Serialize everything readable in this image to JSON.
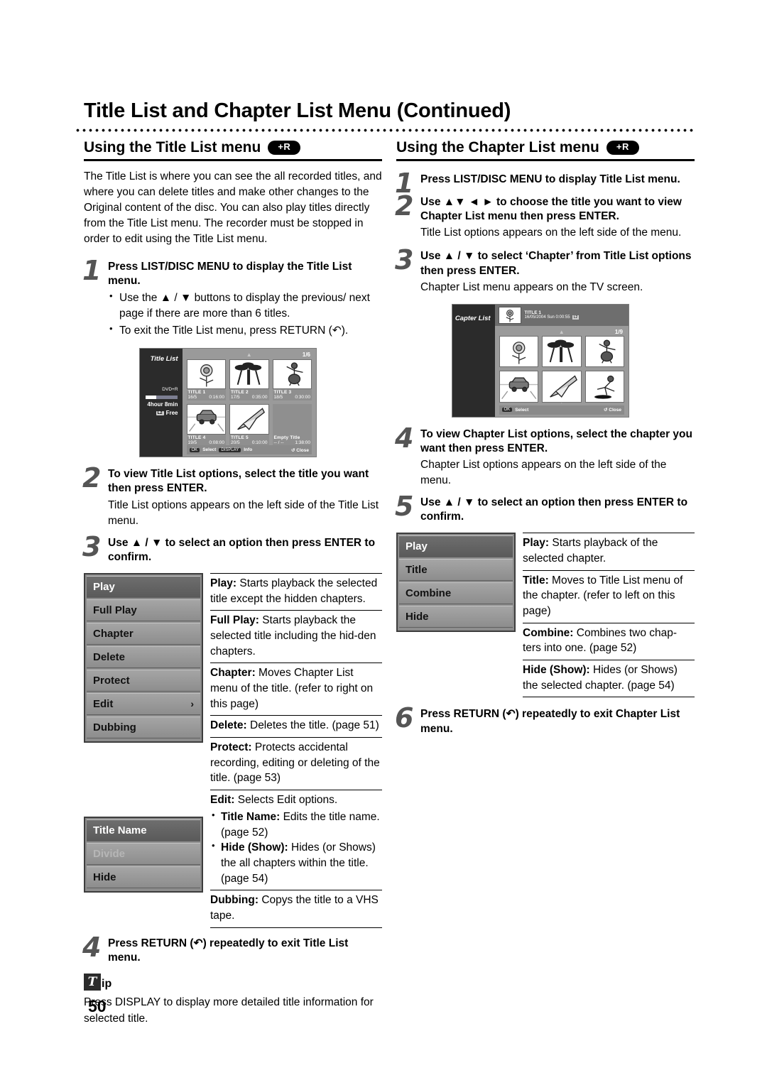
{
  "page": {
    "title": "Title List and Chapter List Menu (Continued)",
    "number": "50"
  },
  "left": {
    "heading": "Using the Title List menu",
    "badge": "+R",
    "intro": "The Title List is where you can see the all recorded titles, and where you can delete titles and make other changes to the Original content of the disc. You can also play titles directly from the Title List menu. The recorder must be stopped in order to edit using the Title List menu.",
    "steps": [
      {
        "num": "1",
        "head": "Press LIST/DISC MENU to display the Title List menu.",
        "bullets": [
          "Use the ▲ / ▼ buttons to display the previous/ next page if there are more than 6 titles.",
          "To exit the Title List menu, press RETURN (↶)."
        ]
      },
      {
        "num": "2",
        "head": "To view Title List options, select the title you want then press ENTER.",
        "sub": "Title List options appears on the left side of the Title List menu."
      },
      {
        "num": "3",
        "head": "Use ▲ / ▼ to select an option then press ENTER to confirm."
      },
      {
        "num": "4",
        "head": "Press RETURN (↶) repeatedly to exit Title List menu."
      }
    ],
    "menu": {
      "items": [
        {
          "label": "Play",
          "state": "selected"
        },
        {
          "label": "Full Play",
          "state": "normal"
        },
        {
          "label": "Chapter",
          "state": "normal"
        },
        {
          "label": "Delete",
          "state": "normal"
        },
        {
          "label": "Protect",
          "state": "normal"
        },
        {
          "label": "Edit",
          "state": "normal",
          "arrow": "›"
        },
        {
          "label": "Dubbing",
          "state": "normal"
        }
      ]
    },
    "submenu": {
      "items": [
        {
          "label": "Title Name",
          "state": "selected"
        },
        {
          "label": "Divide",
          "state": "dim"
        },
        {
          "label": "Hide",
          "state": "normal"
        }
      ]
    },
    "descriptions": [
      {
        "term": "Play:",
        "text": " Starts playback the selected title except the hidden chapters."
      },
      {
        "term": "Full Play:",
        "text": " Starts playback the selected title including the hid-den chapters."
      },
      {
        "term": "Chapter:",
        "text": " Moves Chapter List menu of the title. (refer to right on this page)"
      },
      {
        "term": "Delete:",
        "text": " Deletes the title. (page 51)"
      },
      {
        "term": "Protect:",
        "text": " Protects accidental recording, editing or deleting of the title. (page 53)"
      },
      {
        "term": "Edit:",
        "text": " Selects Edit options.",
        "sub_items": [
          {
            "term": "Title Name:",
            "text": " Edits the title name. (page 52)"
          },
          {
            "term": "Hide (Show):",
            "text": " Hides (or Shows) the all chapters within the title. (page 54)"
          }
        ]
      },
      {
        "term": "Dubbing:",
        "text": " Copys the title to a VHS tape."
      }
    ],
    "tip": {
      "icon_letter": "T",
      "word": "ip",
      "text": "Press DISPLAY to display more detailed title information for selected title."
    },
    "screen": {
      "sidebar_title": "Title List",
      "disc_type": "DVD+R",
      "free_time": "4hour 8min",
      "free_label": "Free",
      "free_chip": "L2",
      "page_indicator": "1/6",
      "cells": [
        {
          "name": "TITLE 1",
          "date": "16/5",
          "time": "0:16:00",
          "art": "rose"
        },
        {
          "name": "TITLE 2",
          "date": "17/5",
          "time": "0:35:00",
          "art": "tree"
        },
        {
          "name": "TITLE 3",
          "date": "18/5",
          "time": "0:30:00",
          "art": "figure"
        },
        {
          "name": "TITLE 4",
          "date": "19/5",
          "time": "0:08:00",
          "art": "car"
        },
        {
          "name": "TITLE 5",
          "date": "20/5",
          "time": "0:10:00",
          "art": "shuttle"
        },
        {
          "name": "Empty Title",
          "date": "-- / --",
          "time": "1:38:00",
          "art": "none"
        }
      ],
      "footer": [
        {
          "key": "OK",
          "label": "Select"
        },
        {
          "key": "DISPLAY",
          "label": "Info"
        }
      ],
      "footer_right": "Close"
    }
  },
  "right": {
    "heading": "Using the Chapter List menu",
    "badge": "+R",
    "steps": [
      {
        "num": "1",
        "head": "Press LIST/DISC MENU to display Title List menu."
      },
      {
        "num": "2",
        "head": "Use ▲▼ ◄ ► to choose the title you want to view Chapter List menu then press ENTER.",
        "sub": "Title List options appears on the left side of the menu."
      },
      {
        "num": "3",
        "head": "Use ▲ / ▼ to select ‘Chapter’ from Title List options then press ENTER.",
        "sub": "Chapter List menu appears on the TV screen."
      },
      {
        "num": "4",
        "head": "To view Chapter List options, select the chapter you want then press ENTER.",
        "sub": "Chapter List options appears on the left side of the menu."
      },
      {
        "num": "5",
        "head": "Use ▲ / ▼ to select an option then press ENTER to confirm."
      },
      {
        "num": "6",
        "head": "Press RETURN (↶) repeatedly to exit Chapter List menu."
      }
    ],
    "menu": {
      "items": [
        {
          "label": "Play",
          "state": "selected"
        },
        {
          "label": "Title",
          "state": "normal"
        },
        {
          "label": "Combine",
          "state": "normal"
        },
        {
          "label": "Hide",
          "state": "normal"
        }
      ]
    },
    "descriptions": [
      {
        "term": "Play:",
        "text": " Starts playback of the selected chapter."
      },
      {
        "term": "Title:",
        "text": " Moves to Title List menu of the chapter. (refer to left on this page)"
      },
      {
        "term": "Combine:",
        "text": " Combines two chap-ters into one. (page 52)"
      },
      {
        "term": "Hide (Show):",
        "text": " Hides (or Shows) the selected chapter. (page 54)"
      }
    ],
    "screen": {
      "sidebar_title": "Capter List",
      "header_title": "TITLE 1",
      "header_sub": "16/05/2004 Sun 0:00:55",
      "header_chip": "L2",
      "page_indicator": "1/9",
      "cells": [
        {
          "art": "rose"
        },
        {
          "art": "tree"
        },
        {
          "art": "figure"
        },
        {
          "art": "car"
        },
        {
          "art": "shuttle"
        },
        {
          "art": "dancer"
        }
      ],
      "footer": [
        {
          "key": "OK",
          "label": "Select"
        }
      ],
      "footer_right": "Close"
    }
  },
  "colors": {
    "screen_bg": "#9a9a9a",
    "sidebar_bg": "#2b2b2b",
    "menu_selected": "#5f5f5f",
    "badge_bg": "#000000"
  }
}
